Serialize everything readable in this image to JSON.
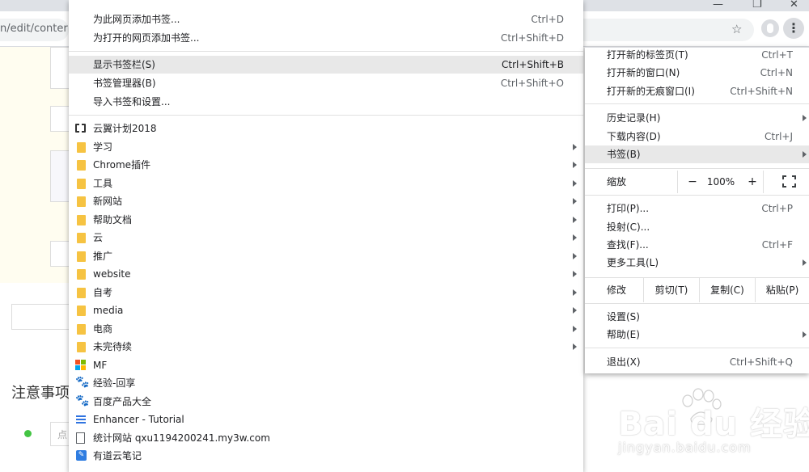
{
  "browser": {
    "url_fragment": "n/edit/conter",
    "bookmark_star": "☆",
    "menu_icon": "⋮"
  },
  "page": {
    "notes_heading": "注意事项",
    "input_placeholder": "点",
    "watermark_brand": "Bai  du 经验",
    "watermark_url": "jingyan.baidu.com"
  },
  "bookmarks_submenu": {
    "actions": [
      {
        "label": "为此网页添加书签...",
        "shortcut": "Ctrl+D"
      },
      {
        "label": "为打开的网页添加书签...",
        "shortcut": "Ctrl+Shift+D"
      }
    ],
    "manage": [
      {
        "label": "显示书签栏(S)",
        "shortcut": "Ctrl+Shift+B",
        "highlighted": true
      },
      {
        "label": "书签管理器(B)",
        "shortcut": "Ctrl+Shift+O"
      },
      {
        "label": "导入书签和设置...",
        "shortcut": ""
      }
    ],
    "bookmarks": [
      {
        "label": "云翼计划2018",
        "icon": "cloud-bracket-icon",
        "folder": false
      },
      {
        "label": "学习",
        "icon": "folder-icon",
        "folder": true
      },
      {
        "label": "Chrome插件",
        "icon": "folder-icon",
        "folder": true
      },
      {
        "label": "工具",
        "icon": "folder-icon",
        "folder": true
      },
      {
        "label": "新网站",
        "icon": "folder-icon",
        "folder": true
      },
      {
        "label": "帮助文档",
        "icon": "folder-icon",
        "folder": true
      },
      {
        "label": "云",
        "icon": "folder-icon",
        "folder": true
      },
      {
        "label": "推广",
        "icon": "folder-icon",
        "folder": true
      },
      {
        "label": "website",
        "icon": "folder-icon",
        "folder": true
      },
      {
        "label": "自考",
        "icon": "folder-icon",
        "folder": true
      },
      {
        "label": "media",
        "icon": "folder-icon",
        "folder": true
      },
      {
        "label": "电商",
        "icon": "folder-icon",
        "folder": true
      },
      {
        "label": "未完待续",
        "icon": "folder-icon",
        "folder": true
      },
      {
        "label": "MF",
        "icon": "microsoft-icon",
        "folder": false
      },
      {
        "label": "经验-回享",
        "icon": "baidu-paw-icon",
        "folder": false
      },
      {
        "label": "百度产品大全",
        "icon": "baidu-paw-icon",
        "folder": false
      },
      {
        "label": "Enhancer - Tutorial",
        "icon": "list-lines-icon",
        "folder": false
      },
      {
        "label": "统计网站 qxu1194200241.my3w.com",
        "icon": "page-icon",
        "folder": false
      },
      {
        "label": "有道云笔记",
        "icon": "note-icon",
        "folder": false
      }
    ]
  },
  "main_menu": {
    "group1": [
      {
        "label": "打开新的标签页(T)",
        "shortcut": "Ctrl+T"
      },
      {
        "label": "打开新的窗口(N)",
        "shortcut": "Ctrl+N"
      },
      {
        "label": "打开新的无痕窗口(I)",
        "shortcut": "Ctrl+Shift+N"
      }
    ],
    "group2": [
      {
        "label": "历史记录(H)",
        "shortcut": "",
        "submenu": true
      },
      {
        "label": "下载内容(D)",
        "shortcut": "Ctrl+J",
        "submenu": false
      },
      {
        "label": "书签(B)",
        "shortcut": "",
        "submenu": true,
        "highlighted": true
      }
    ],
    "zoom": {
      "label": "缩放",
      "minus": "−",
      "value": "100%",
      "plus": "+"
    },
    "group3": [
      {
        "label": "打印(P)...",
        "shortcut": "Ctrl+P",
        "submenu": false
      },
      {
        "label": "投射(C)...",
        "shortcut": "",
        "submenu": false
      },
      {
        "label": "查找(F)...",
        "shortcut": "Ctrl+F",
        "submenu": false
      },
      {
        "label": "更多工具(L)",
        "shortcut": "",
        "submenu": true
      }
    ],
    "edit": {
      "label": "修改",
      "cut": "剪切(T)",
      "copy": "复制(C)",
      "paste": "粘贴(P)"
    },
    "group4": [
      {
        "label": "设置(S)",
        "shortcut": "",
        "submenu": false
      },
      {
        "label": "帮助(E)",
        "shortcut": "",
        "submenu": true
      }
    ],
    "exit": {
      "label": "退出(X)",
      "shortcut": "Ctrl+Shift+Q"
    }
  },
  "colors": {
    "folder": "#f6c342",
    "highlight": "#e8e8e8",
    "baidu_blue": "#2f73e0",
    "status_green": "#43c443"
  }
}
